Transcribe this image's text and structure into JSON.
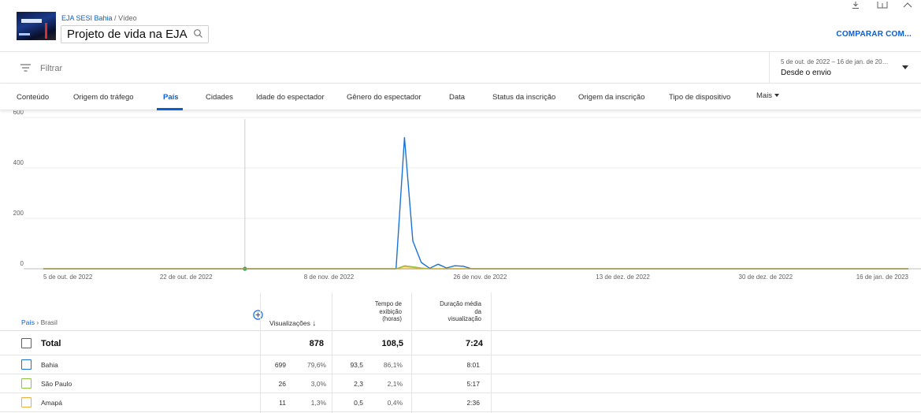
{
  "header": {
    "channel": "EJA SESI Bahia",
    "separator": " / ",
    "section": "Vídeo",
    "video_title": "Projeto de vida na EJA",
    "compare_label": "COMPARAR COM..."
  },
  "filter": {
    "placeholder": "Filtrar"
  },
  "date": {
    "range": "5 de out. de 2022 – 16 de jan. de 20…",
    "selection": "Desde o envio"
  },
  "tabs": [
    {
      "label": "Conteúdo"
    },
    {
      "label": "Origem do tráfego"
    },
    {
      "label": "País"
    },
    {
      "label": "Cidades"
    },
    {
      "label": "Idade do espectador"
    },
    {
      "label": "Gênero do espectador"
    },
    {
      "label": "Data"
    },
    {
      "label": "Status da inscrição"
    },
    {
      "label": "Origem da inscrição"
    },
    {
      "label": "Tipo de dispositivo"
    },
    {
      "label": "Mais"
    }
  ],
  "active_tab": "País",
  "colors": {
    "accent": "#065fd4",
    "bahia": "#1a73d4",
    "sao_paulo": "#8fc640",
    "amapa": "#f0ad3e"
  },
  "chart_data": {
    "type": "line",
    "y_ticks": [
      "600",
      "400",
      "200",
      "0"
    ],
    "ylim": [
      0,
      600
    ],
    "x_ticks": [
      "5 de out. de 2022",
      "22 de out. de 2022",
      "8 de nov. de 2022",
      "26 de nov. de 2022",
      "13 de dez. de 2022",
      "30 de dez. de 2022",
      "16 de jan. de 2023"
    ],
    "x": [
      "2022-10-05",
      "2022-11-16",
      "2022-11-17",
      "2022-11-18",
      "2022-11-19",
      "2022-11-20",
      "2022-11-21",
      "2022-11-22",
      "2022-11-23",
      "2022-11-24",
      "2022-11-25",
      "2023-01-16"
    ],
    "series": [
      {
        "name": "Bahia",
        "values": [
          0,
          0,
          520,
          110,
          25,
          2,
          18,
          3,
          12,
          10,
          0,
          0
        ]
      },
      {
        "name": "São Paulo",
        "values": [
          0,
          0,
          12,
          8,
          3,
          0,
          0,
          0,
          0,
          0,
          0,
          0
        ]
      },
      {
        "name": "Amapá",
        "values": [
          0,
          0,
          8,
          5,
          2,
          0,
          0,
          0,
          0,
          0,
          0,
          0
        ]
      }
    ],
    "marker_date": "2022-10-29"
  },
  "table": {
    "breadcrumb_parent": "País",
    "breadcrumb_sep": " › ",
    "breadcrumb_child": "Brasil",
    "col_views": "Visualizações",
    "sort_arrow": "↓",
    "col_watch": [
      "Tempo de",
      "exibição",
      "(horas)"
    ],
    "col_avg": [
      "Duração média",
      "da",
      "visualização"
    ],
    "total": {
      "label": "Total",
      "views": "878",
      "watch": "108,5",
      "avg": "7:24"
    },
    "rows": [
      {
        "label": "Bahia",
        "views": "699",
        "views_pct": "79,6%",
        "watch": "93,5",
        "watch_pct": "86,1%",
        "avg": "8:01"
      },
      {
        "label": "São Paulo",
        "views": "26",
        "views_pct": "3,0%",
        "watch": "2,3",
        "watch_pct": "2,1%",
        "avg": "5:17"
      },
      {
        "label": "Amapá",
        "views": "11",
        "views_pct": "1,3%",
        "watch": "0,5",
        "watch_pct": "0,4%",
        "avg": "2:36"
      }
    ]
  }
}
